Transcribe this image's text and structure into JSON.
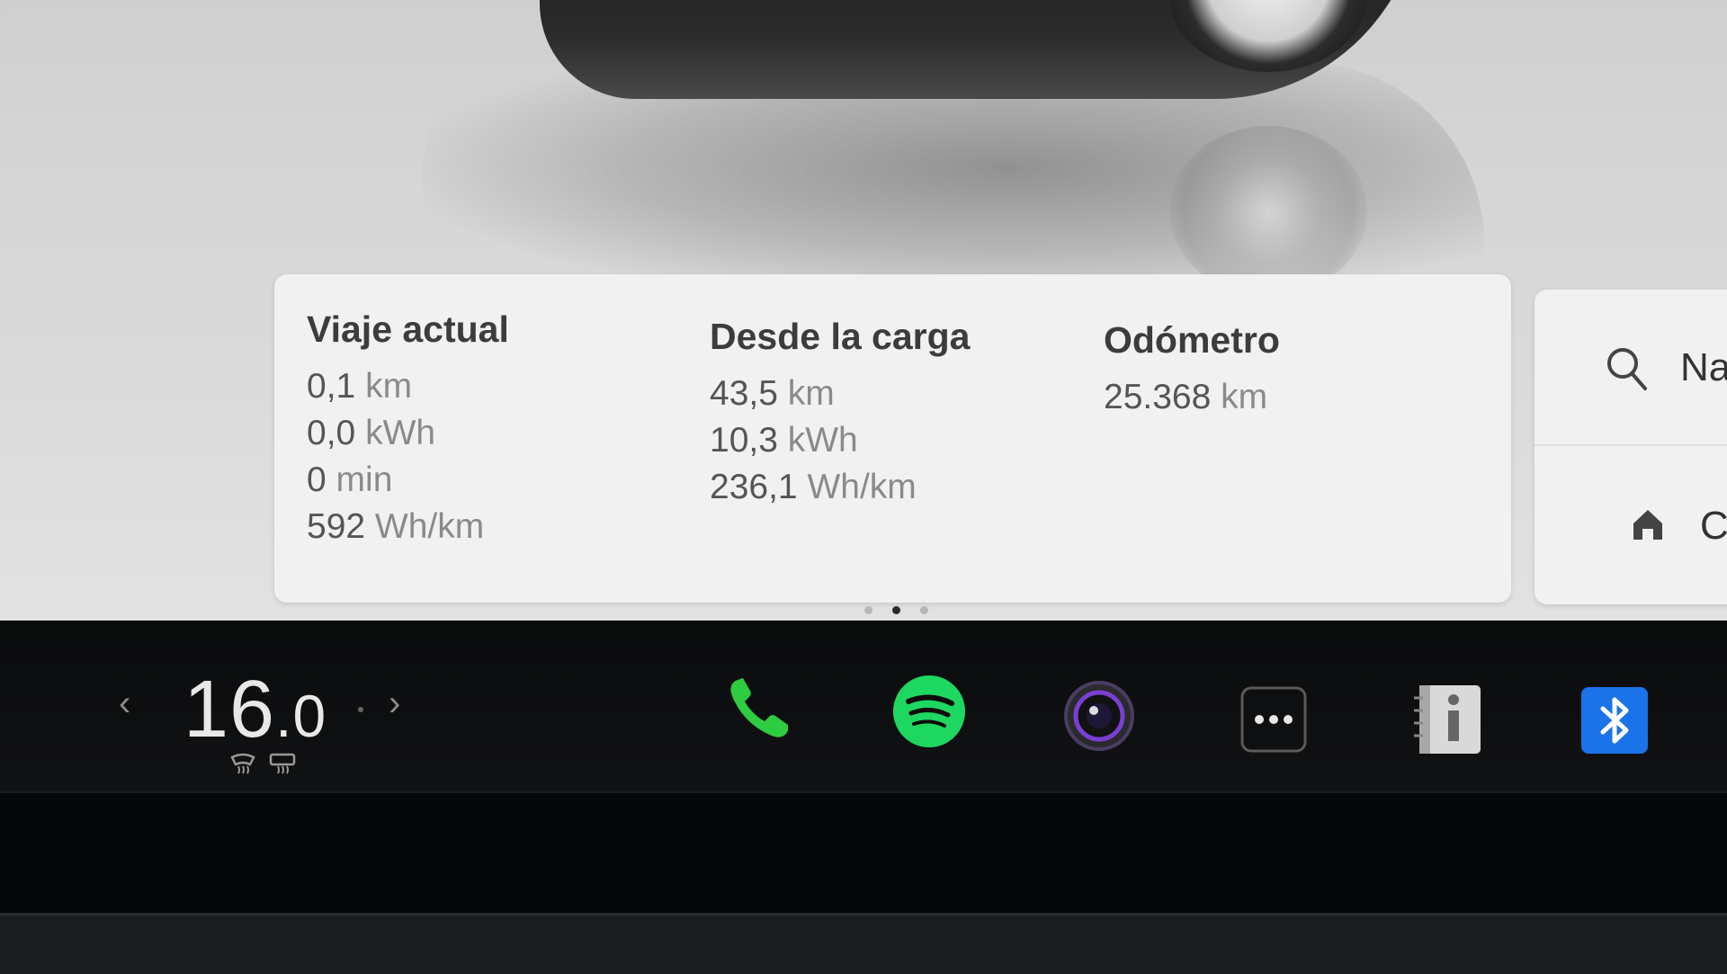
{
  "trip_card": {
    "current_trip": {
      "title": "Viaje actual",
      "distance": {
        "value": "0,1",
        "unit": "km"
      },
      "energy": {
        "value": "0,0",
        "unit": "kWh"
      },
      "time": {
        "value": "0",
        "unit": "min"
      },
      "consumption": {
        "value": "592",
        "unit": "Wh/km"
      }
    },
    "since_charge": {
      "title": "Desde la carga",
      "distance": {
        "value": "43,5",
        "unit": "km"
      },
      "energy": {
        "value": "10,3",
        "unit": "kWh"
      },
      "consumption": {
        "value": "236,1",
        "unit": "Wh/km"
      }
    },
    "odometer": {
      "title": "Odómetro",
      "distance": {
        "value": "25.368",
        "unit": "km"
      }
    }
  },
  "side_card": {
    "search_label": "Na",
    "home_label": "C"
  },
  "page_indicator": {
    "count": 3,
    "active": 2
  },
  "climate": {
    "temperature_int": "16",
    "temperature_dec": ".0",
    "left_arrow": "‹",
    "right_arrow": "›"
  },
  "dock": {
    "icons": [
      "phone-icon",
      "spotify-icon",
      "camera-icon",
      "more-icon",
      "manual-icon",
      "bluetooth-icon"
    ],
    "colors": {
      "phone": "#2ecc40",
      "spotify": "#1ed760",
      "bluetooth": "#1a73e8"
    }
  }
}
